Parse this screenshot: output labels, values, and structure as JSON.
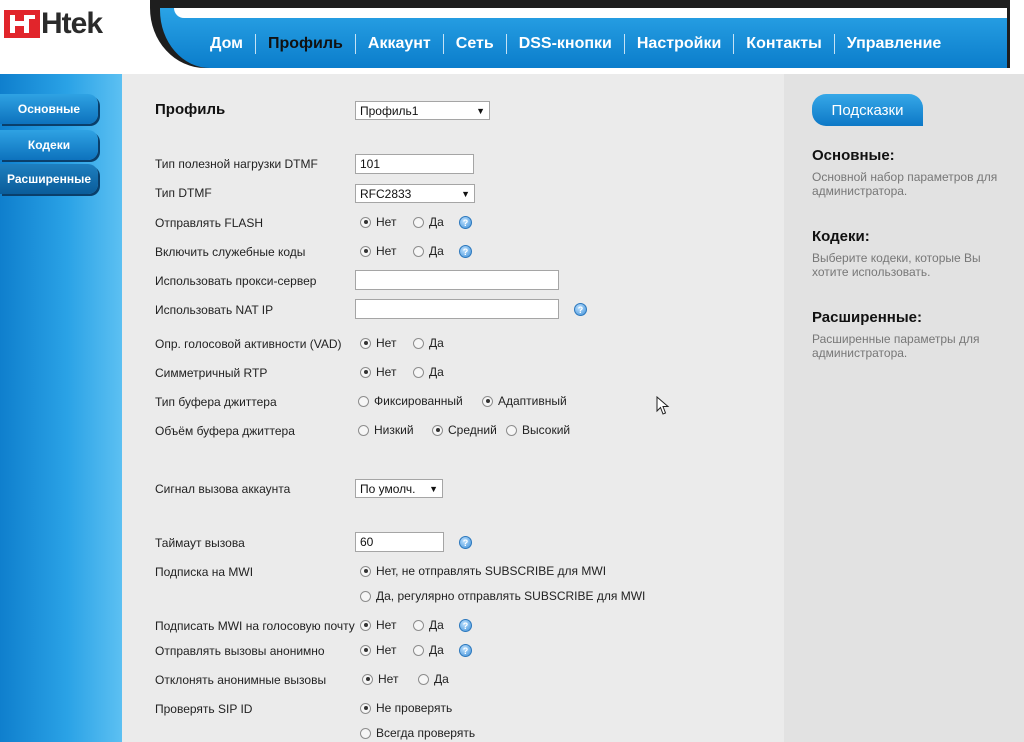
{
  "logo": {
    "text": "Htek"
  },
  "nav": {
    "items": [
      "Дом",
      "Профиль",
      "Аккаунт",
      "Сеть",
      "DSS-кнопки",
      "Настройки",
      "Контакты",
      "Управление"
    ],
    "active": "Профиль"
  },
  "sidebar": {
    "items": [
      "Основные",
      "Кодеки",
      "Расширенные"
    ]
  },
  "form": {
    "title": "Профиль",
    "profile_select": "Профиль1",
    "dtmf_payload": {
      "label": "Тип полезной нагрузки DTMF",
      "value": "101"
    },
    "dtmf_type": {
      "label": "Тип DTMF",
      "value": "RFC2833"
    },
    "send_flash": {
      "label": "Отправлять FLASH",
      "opt_no": "Нет",
      "opt_yes": "Да",
      "selected": "Нет"
    },
    "service_codes": {
      "label": "Включить служебные коды",
      "opt_no": "Нет",
      "opt_yes": "Да",
      "selected": "Нет"
    },
    "proxy": {
      "label": "Использовать прокси-сервер",
      "value": ""
    },
    "nat_ip": {
      "label": "Использовать NAT IP",
      "value": ""
    },
    "vad": {
      "label": "Опр. голосовой активности (VAD)",
      "opt_no": "Нет",
      "opt_yes": "Да",
      "selected": "Нет"
    },
    "sym_rtp": {
      "label": "Симметричный RTP",
      "opt_no": "Нет",
      "opt_yes": "Да",
      "selected": "Нет"
    },
    "jitter_type": {
      "label": "Тип буфера джиттера",
      "opt_fixed": "Фиксированный",
      "opt_adaptive": "Адаптивный",
      "selected": "Адаптивный"
    },
    "jitter_size": {
      "label": "Объём буфера джиттера",
      "opt_low": "Низкий",
      "opt_mid": "Средний",
      "opt_high": "Высокий",
      "selected": "Средний"
    },
    "ring_signal": {
      "label": "Сигнал вызова аккаунта",
      "value": "По умолч."
    },
    "call_timeout": {
      "label": "Таймаут вызова",
      "value": "60"
    },
    "mwi_subscribe": {
      "label": "Подписка на MWI",
      "opt_no": "Нет, не отправлять SUBSCRIBE для MWI",
      "opt_yes": "Да, регулярно отправлять SUBSCRIBE для MWI",
      "selected": "no"
    },
    "mwi_voicemail": {
      "label": "Подписать MWI на голосовую почту",
      "opt_no": "Нет",
      "opt_yes": "Да",
      "selected": "Нет"
    },
    "anon_calls": {
      "label": "Отправлять вызовы анонимно",
      "opt_no": "Нет",
      "opt_yes": "Да",
      "selected": "Нет"
    },
    "reject_anon": {
      "label": "Отклонять анонимные вызовы",
      "opt_no": "Нет",
      "opt_yes": "Да",
      "selected": "Нет"
    },
    "check_sip_id": {
      "label": "Проверять SIP ID",
      "opt_never": "Не проверять",
      "opt_always": "Всегда проверять",
      "selected": "never"
    }
  },
  "hints": {
    "tab": "Подсказки",
    "sections": [
      {
        "title": "Основные:",
        "text": "Основной набор параметров для администратора."
      },
      {
        "title": "Кодеки:",
        "text": "Выберите кодеки, которые Вы хотите использовать."
      },
      {
        "title": "Расширенные:",
        "text": "Расширенные параметры для администратора."
      }
    ]
  },
  "help_icon": "question-help-icon"
}
